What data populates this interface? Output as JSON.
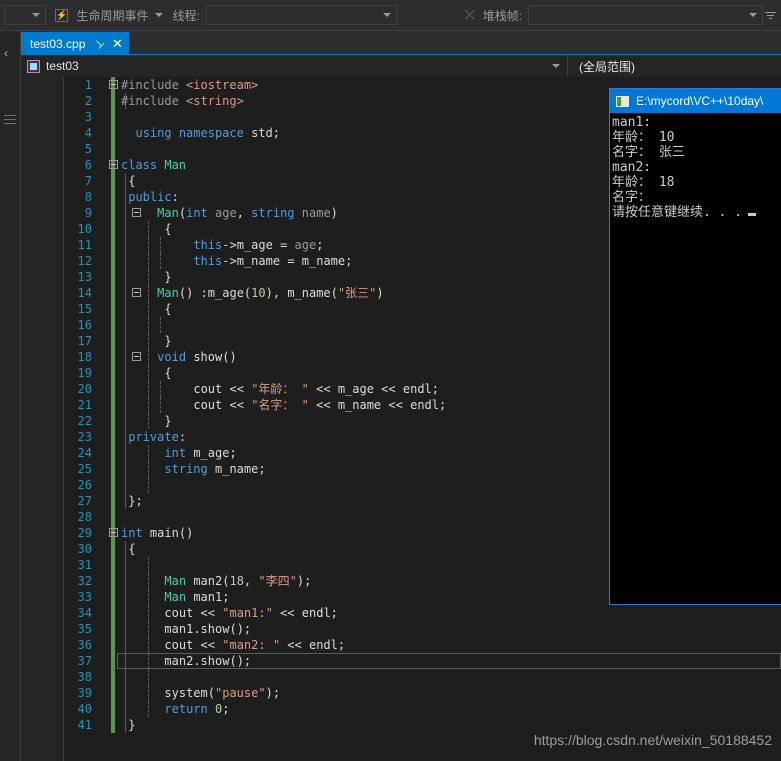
{
  "toolbar": {
    "process_combo_value": "",
    "lifecycle_icon": "lifecycle-events-icon",
    "lifecycle_label": "生命周期事件",
    "thread_label": "线程:",
    "thread_combo_value": "",
    "filter_icon": "filter-icon",
    "filter_down_icon": "filter-down-icon",
    "flags_icon": "flags-icon",
    "stackframe_label": "堆栈帧:",
    "stackframe_combo_value": "",
    "overflow_icon": "toolbar-overflow-icon"
  },
  "left_strip": {
    "chevron_icon": "chevron-left-icon",
    "grip_icon": "dock-grip-icon"
  },
  "tab": {
    "label": "test03.cpp",
    "pin_icon": "pin-icon",
    "close_icon": "close-icon"
  },
  "navbar": {
    "project_icon": "project-icon",
    "project_name": "test03",
    "dropdown_icon": "chevron-down-icon",
    "scope": "(全局范围)"
  },
  "editor": {
    "current_line": 37,
    "lines": [
      {
        "n": 1,
        "text": "#include <iostream>"
      },
      {
        "n": 2,
        "text": "#include <string>"
      },
      {
        "n": 3,
        "text": ""
      },
      {
        "n": 4,
        "text": "  using namespace std;"
      },
      {
        "n": 5,
        "text": ""
      },
      {
        "n": 6,
        "text": "class Man"
      },
      {
        "n": 7,
        "text": " {"
      },
      {
        "n": 8,
        "text": " public:"
      },
      {
        "n": 9,
        "text": "     Man(int age, string name)"
      },
      {
        "n": 10,
        "text": "      {"
      },
      {
        "n": 11,
        "text": "          this->m_age = age;"
      },
      {
        "n": 12,
        "text": "          this->m_name = m_name;"
      },
      {
        "n": 13,
        "text": "      }"
      },
      {
        "n": 14,
        "text": "     Man() :m_age(10), m_name(\"张三\")"
      },
      {
        "n": 15,
        "text": "      {"
      },
      {
        "n": 16,
        "text": ""
      },
      {
        "n": 17,
        "text": "      }"
      },
      {
        "n": 18,
        "text": "     void show()"
      },
      {
        "n": 19,
        "text": "      {"
      },
      {
        "n": 20,
        "text": "          cout << \"年龄： \" << m_age << endl;"
      },
      {
        "n": 21,
        "text": "          cout << \"名字： \" << m_name << endl;"
      },
      {
        "n": 22,
        "text": "      }"
      },
      {
        "n": 23,
        "text": " private:"
      },
      {
        "n": 24,
        "text": "      int m_age;"
      },
      {
        "n": 25,
        "text": "      string m_name;"
      },
      {
        "n": 26,
        "text": ""
      },
      {
        "n": 27,
        "text": " };"
      },
      {
        "n": 28,
        "text": ""
      },
      {
        "n": 29,
        "text": "int main()"
      },
      {
        "n": 30,
        "text": " {"
      },
      {
        "n": 31,
        "text": ""
      },
      {
        "n": 32,
        "text": "      Man man2(18, \"李四\");"
      },
      {
        "n": 33,
        "text": "      Man man1;"
      },
      {
        "n": 34,
        "text": "      cout << \"man1:\" << endl;"
      },
      {
        "n": 35,
        "text": "      man1.show();"
      },
      {
        "n": 36,
        "text": "      cout << \"man2: \" << endl;"
      },
      {
        "n": 37,
        "text": "      man2.show();"
      },
      {
        "n": 38,
        "text": ""
      },
      {
        "n": 39,
        "text": "      system(\"pause\");"
      },
      {
        "n": 40,
        "text": "      return 0;"
      },
      {
        "n": 41,
        "text": " }"
      }
    ]
  },
  "console": {
    "icon": "console-window-icon",
    "title": "E:\\mycord\\VC++\\10day\\",
    "output": "man1:\n年龄： 10\n名字： 张三\nman2:\n年龄： 18\n名字：\n请按任意键继续. . ."
  },
  "watermark": {
    "text": "https://blog.csdn.net/weixin_50188452"
  },
  "colors": {
    "accent": "#007acc",
    "editor_bg": "#1e1e1e",
    "chrome_bg": "#2d2d30",
    "changebar_green": "#57994a",
    "console_title": "#0078d7",
    "linenumber": "#2b91af",
    "keyword": "#569cd6",
    "type": "#4ec9b0",
    "string": "#d69d85"
  }
}
